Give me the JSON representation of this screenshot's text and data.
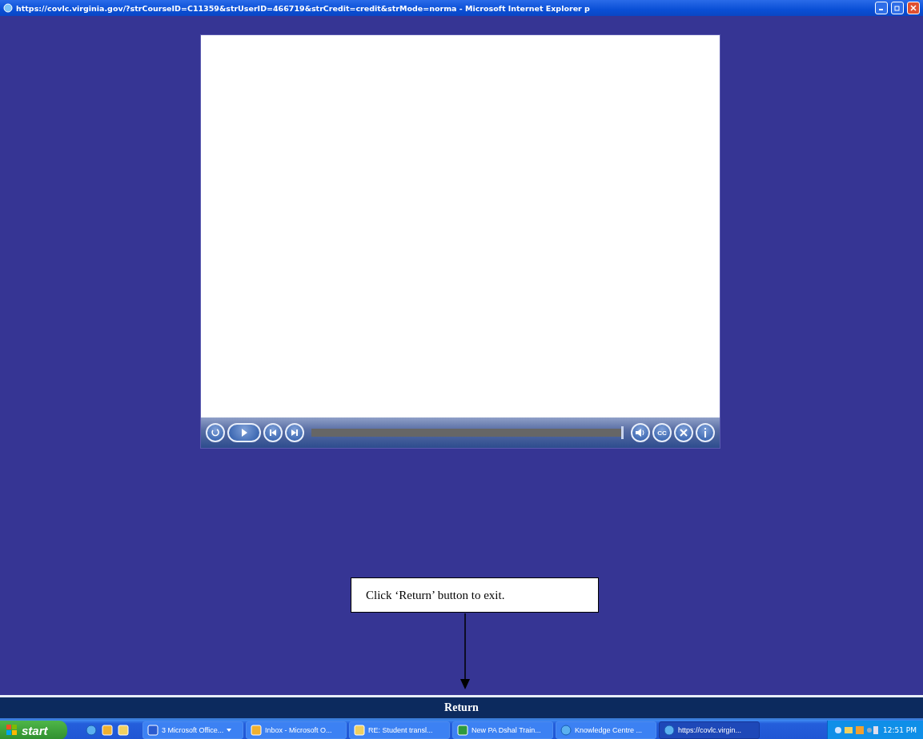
{
  "window": {
    "title": "https://covlc.virginia.gov/?strCourseID=C11359&strUserID=466719&strCredit=credit&strMode=norma - Microsoft Internet Explorer p"
  },
  "player": {
    "controls": [
      {
        "kind": "replay"
      },
      {
        "kind": "play"
      },
      {
        "kind": "previous"
      },
      {
        "kind": "next"
      }
    ],
    "progress": {
      "level": 1
    },
    "right_controls": [
      {
        "kind": "volume"
      },
      {
        "kind": "captions",
        "label": "CC"
      },
      {
        "kind": "close"
      },
      {
        "kind": "info"
      }
    ]
  },
  "callout": {
    "text": "Click ‘Return’ button to exit."
  },
  "return_bar": {
    "label": "Return"
  },
  "taskbar": {
    "start": "start",
    "tasks": [
      {
        "label": "3 Microsoft Office...",
        "kind": "word",
        "group": true,
        "selected": false
      },
      {
        "label": "Inbox - Microsoft O...",
        "kind": "outlook",
        "group": false,
        "selected": false
      },
      {
        "label": "RE: Student transl...",
        "kind": "mail",
        "group": false,
        "selected": false
      },
      {
        "label": "New PA Dshal Train...",
        "kind": "excel",
        "group": false,
        "selected": false
      },
      {
        "label": "Knowledge Centre ...",
        "kind": "ie",
        "group": false,
        "selected": false
      },
      {
        "label": "https://covlc.virgin...",
        "kind": "ie",
        "group": false,
        "selected": true
      }
    ],
    "clock": "12:51 PM"
  }
}
